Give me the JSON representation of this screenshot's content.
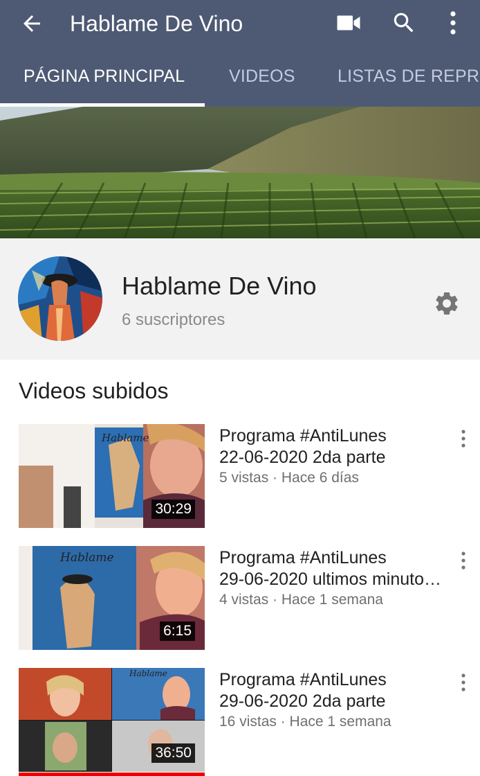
{
  "appbar": {
    "title": "Hablame De Vino",
    "icons": [
      "back-arrow-icon",
      "video-camera-icon",
      "search-icon",
      "more-vert-icon"
    ]
  },
  "tabs": [
    {
      "label": "PÁGINA PRINCIPAL",
      "active": true
    },
    {
      "label": "VIDEOS",
      "active": false
    },
    {
      "label": "LISTAS DE REPRO",
      "active": false
    }
  ],
  "channel": {
    "name": "Hablame De Vino",
    "subscribers": "6 suscriptores"
  },
  "section": {
    "title": "Videos subidos"
  },
  "videos": [
    {
      "line1": "Programa #AntiLunes",
      "line2": "22-06-2020 2da parte",
      "meta": "5 vistas · Hace 6 días",
      "duration": "30:29",
      "watched": 0
    },
    {
      "line1": "Programa #AntiLunes",
      "line2": "29-06-2020 ultimos minuto…",
      "meta": "4 vistas · Hace 1 semana",
      "duration": "6:15",
      "watched": 0
    },
    {
      "line1": "Programa #AntiLunes",
      "line2": "29-06-2020 2da parte",
      "meta": "16 vistas · Hace 1 semana",
      "duration": "36:50",
      "watched": 1
    }
  ],
  "colors": {
    "appbar": "#4e5a74",
    "tab_inactive": "#c3cbe0",
    "channel_bg": "#f2f2f2",
    "progress": "#ee0000"
  }
}
